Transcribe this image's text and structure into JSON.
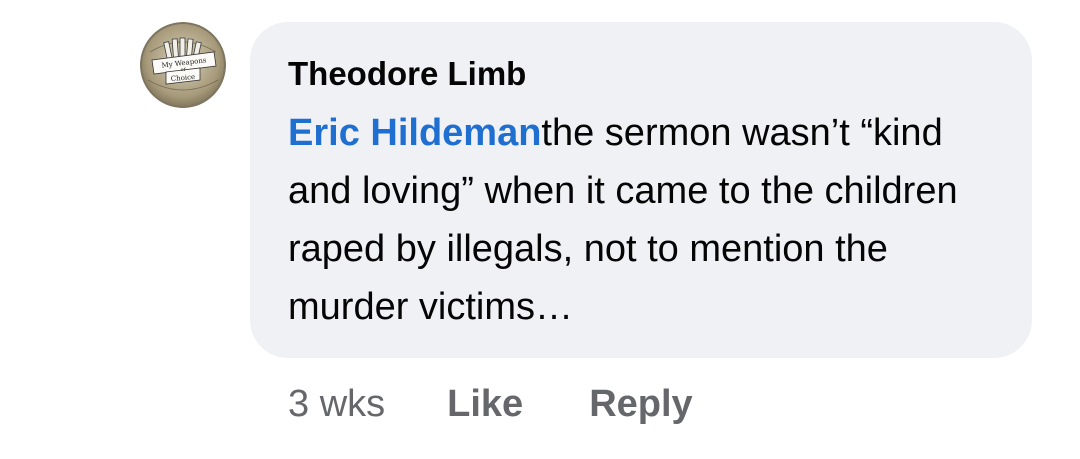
{
  "comment": {
    "author": "Theodore Limb",
    "avatar": {
      "icon": "my-weapons-of-choice-badge-icon",
      "label_lines": [
        "My Weapons",
        "of",
        "Choice"
      ]
    },
    "mention": "Eric Hildeman",
    "text": "the sermon wasn’t “kind and loving” when it came to the children raped by illegals, not to mention the murder victims…",
    "mention_color": "#1f6fd1",
    "bubble_color": "#f0f1f5"
  },
  "actions": {
    "timestamp": "3 wks",
    "like_label": "Like",
    "reply_label": "Reply"
  }
}
